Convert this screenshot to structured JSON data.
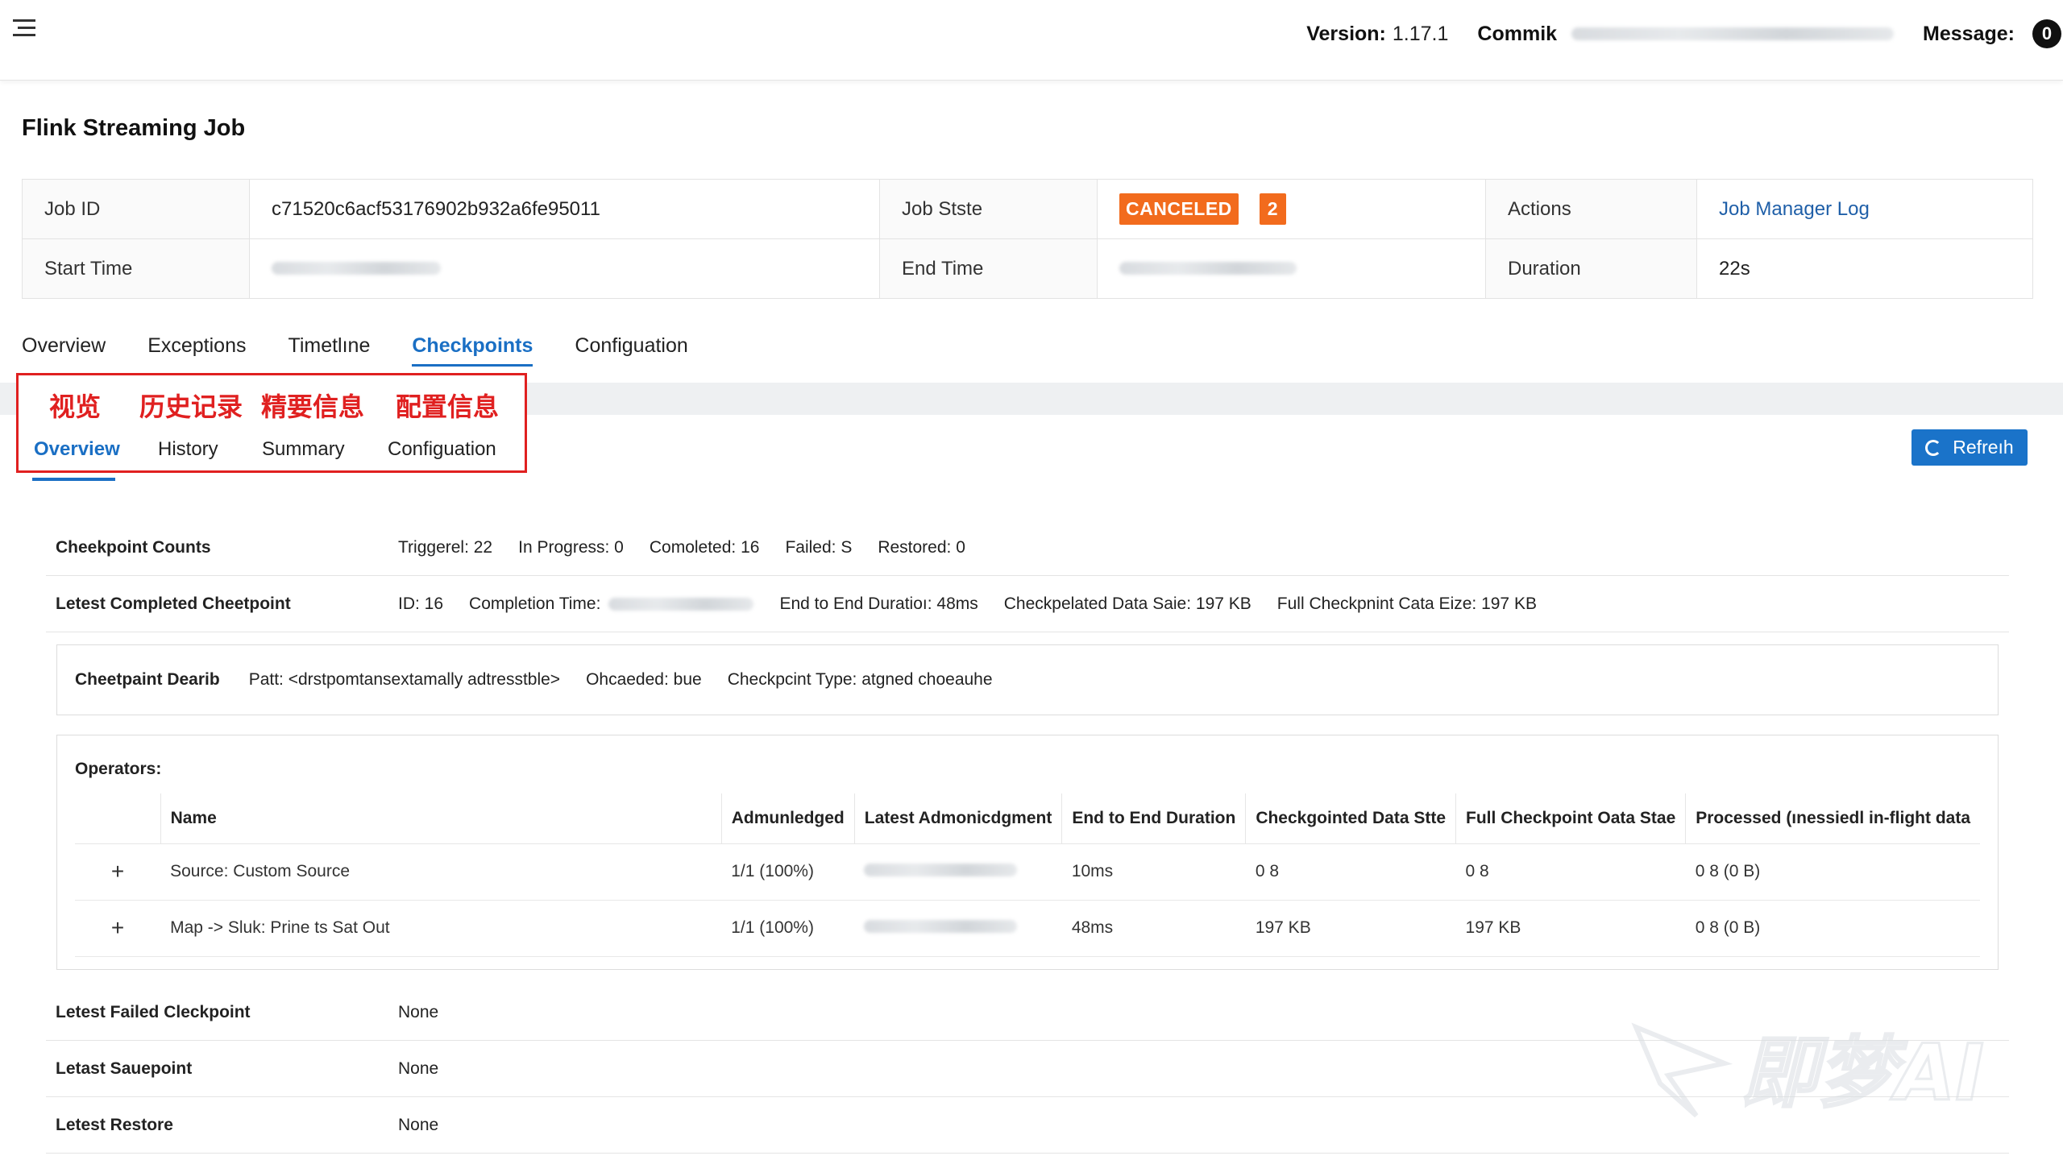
{
  "header": {
    "version_label": "Version:",
    "version_value": "1.17.1",
    "commit_label": "Commik",
    "message_label": "Message:",
    "message_count": "0"
  },
  "job": {
    "title": "Flink Streaming Job",
    "id_label": "Job ID",
    "id_value": "c71520c6acf53176902b932a6fe95011",
    "state_label": "Job Stste",
    "state_value": "CANCELED",
    "state_count": "2",
    "actions_label": "Actions",
    "actions_link": "Job Manager Log",
    "start_label": "Start Time",
    "end_label": "End Time",
    "duration_label": "Duration",
    "duration_value": "22s"
  },
  "main_tabs": [
    "Overview",
    "Exceptions",
    "Timetlıne",
    "Checkpoints",
    "Configuation"
  ],
  "sub_tabs": {
    "cn": [
      "视览",
      "历史记录",
      "精要信息",
      "配置信息"
    ],
    "en": [
      "Overview",
      "History",
      "Summary",
      "Configuation"
    ]
  },
  "refresh_label": "Refreıh",
  "counts": {
    "label": "Cheekpoint Counts",
    "triggered": "Triggerel: 22",
    "in_progress": "In Progress: 0",
    "completed": "Comoleted: 16",
    "failed": "Failed: S",
    "restored": "Restored: 0"
  },
  "latest_completed": {
    "label": "Letest Completed Cheetpoint",
    "id": "ID: 16",
    "completion_label": "Completion Time:",
    "e2e": "End to End Duratioı: 48ms",
    "data_size": "Checkpelated Data Saie: 197 KB",
    "full_size": "Full Checkpnint Cata Eize: 197 KB"
  },
  "detail": {
    "label": "Cheetpaint Dearib",
    "path": "Patt: <drstpomtansextamally adtresstble>",
    "discarded": "Ohcaeded: bue",
    "type": "Checkpcint Type: atgned choeauhe"
  },
  "operators": {
    "title": "Operators:",
    "columns": [
      "Name",
      "Admunledged",
      "Latest Admonicdgment",
      "End to End Duration",
      "Checkgointed Data Stte",
      "Full Checkpoint Oata Stae",
      "Processed (ınessiedl in-flight data"
    ],
    "rows": [
      {
        "expand": "+",
        "name": "Source: Custom Source",
        "ack": "1/1 (100%)",
        "e2e": "10ms",
        "data": "0 8",
        "full": "0 8",
        "processed": "0 8 (0 B)"
      },
      {
        "expand": "+",
        "name": "Map -> Sluk: Prine ts Sat Out",
        "ack": "1/1 (100%)",
        "e2e": "48ms",
        "data": "197 KB",
        "full": "197 KB",
        "processed": "0 8 (0 B)"
      }
    ]
  },
  "failed": {
    "label": "Letest Failed Cleckpoint",
    "value": "None"
  },
  "savepoint": {
    "label": "Letast Sauepoint",
    "value": "None"
  },
  "restore": {
    "label": "Letest Restore",
    "value": "None"
  },
  "watermark_text": "即梦AI"
}
